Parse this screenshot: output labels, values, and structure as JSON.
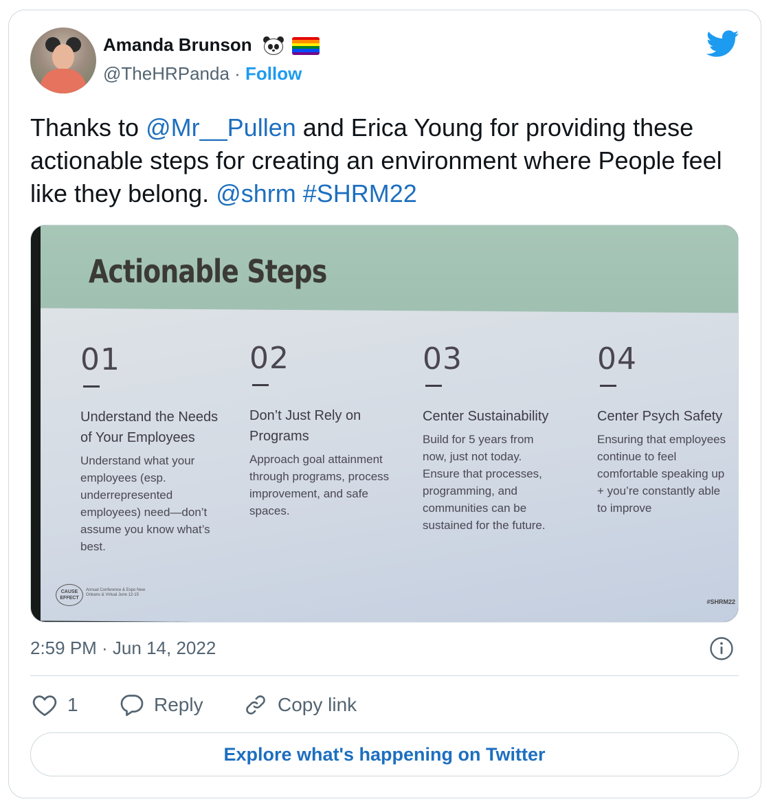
{
  "author": {
    "name": "Amanda Brunson",
    "handle": "@TheHRPanda",
    "separator": " · ",
    "follow_label": "Follow",
    "emojis": [
      "panda-face",
      "rainbow-flag"
    ]
  },
  "tweet": {
    "text_part1": "Thanks to ",
    "mention1": "@Mr__Pullen",
    "text_part2": " and Erica Young for providing these actionable steps for creating an environment where People feel like they belong.  ",
    "mention2": "@shrm",
    "text_space": " ",
    "hashtag": "#SHRM22"
  },
  "slide": {
    "title": "Actionable Steps",
    "steps": [
      {
        "number": "01",
        "heading": "Understand the Needs of Your Employees",
        "description": "Understand what your employees (esp. underrepresented employees) need—don’t assume you know what’s best."
      },
      {
        "number": "02",
        "heading": "Don’t Just Rely on Programs",
        "description": "Approach goal attainment through programs, process improvement, and safe spaces."
      },
      {
        "number": "03",
        "heading": "Center Sustainability",
        "description": "Build for 5 years from now, just not today. Ensure that processes, programming, and communities can be sustained for the future."
      },
      {
        "number": "04",
        "heading": "Center Psych Safety",
        "description": "Ensuring that employees continue to feel comfortable speaking up + you’re constantly able to improve"
      }
    ],
    "logo_text": "CAUSE EFFECT",
    "logo_subtext": "Annual Conference & Expo New Orleans & Virtual June 12-15",
    "hashtag": "#SHRM22"
  },
  "meta": {
    "timestamp": "2:59 PM · Jun 14, 2022"
  },
  "actions": {
    "like_count": "1",
    "reply_label": "Reply",
    "copy_link_label": "Copy link"
  },
  "footer": {
    "explore_label": "Explore what's happening on Twitter"
  },
  "colors": {
    "link_blue": "#1d9bf0",
    "text_primary": "#0f1419",
    "text_secondary": "#536471",
    "border": "#cfd9de",
    "slide_header_green": "#a7c6b7"
  }
}
